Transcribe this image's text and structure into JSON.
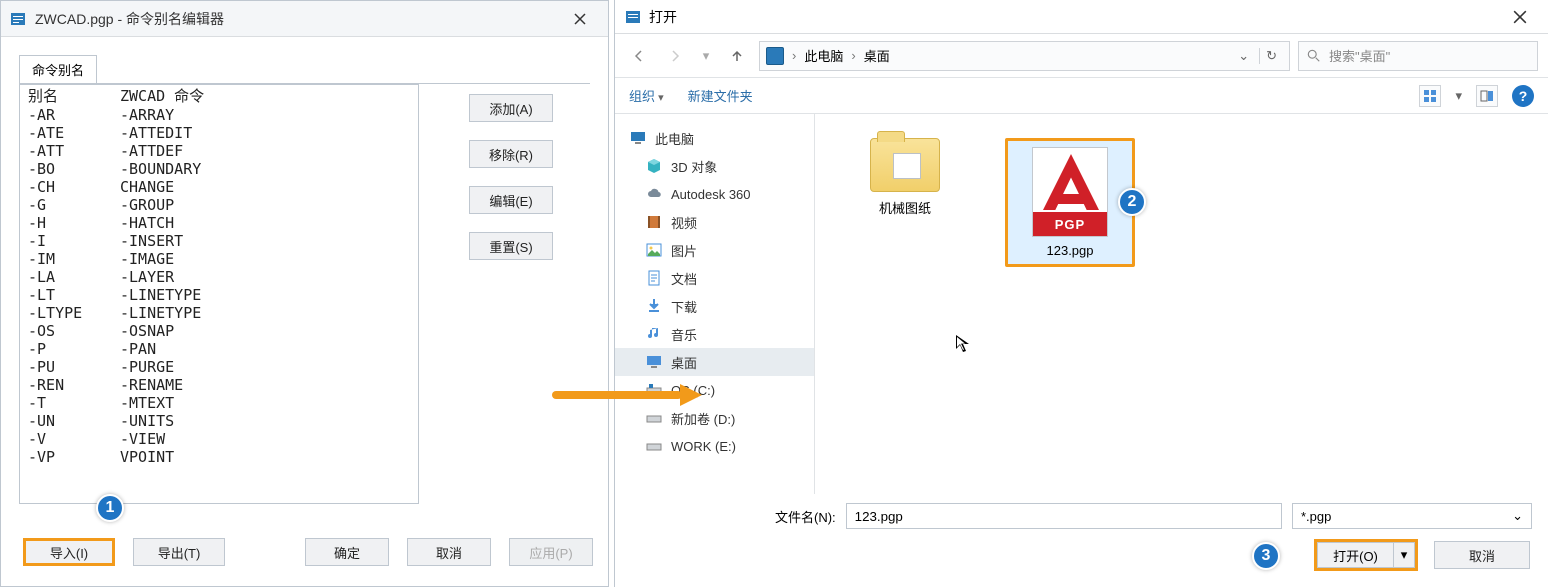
{
  "left": {
    "title": "ZWCAD.pgp - 命令别名编辑器",
    "tab": "命令别名",
    "list_header": {
      "alias": "别名",
      "cmd": "ZWCAD 命令"
    },
    "list": [
      {
        "a": "-AR",
        "c": "-ARRAY"
      },
      {
        "a": "-ATE",
        "c": "-ATTEDIT"
      },
      {
        "a": "-ATT",
        "c": "-ATTDEF"
      },
      {
        "a": "-BO",
        "c": "-BOUNDARY"
      },
      {
        "a": "-CH",
        "c": "CHANGE"
      },
      {
        "a": "-G",
        "c": "-GROUP"
      },
      {
        "a": "-H",
        "c": "-HATCH"
      },
      {
        "a": "-I",
        "c": "-INSERT"
      },
      {
        "a": "-IM",
        "c": "-IMAGE"
      },
      {
        "a": "-LA",
        "c": "-LAYER"
      },
      {
        "a": "-LT",
        "c": "-LINETYPE"
      },
      {
        "a": "-LTYPE",
        "c": "-LINETYPE"
      },
      {
        "a": "-OS",
        "c": "-OSNAP"
      },
      {
        "a": "-P",
        "c": "-PAN"
      },
      {
        "a": "-PU",
        "c": "-PURGE"
      },
      {
        "a": "-REN",
        "c": "-RENAME"
      },
      {
        "a": "-T",
        "c": "-MTEXT"
      },
      {
        "a": "-UN",
        "c": "-UNITS"
      },
      {
        "a": "-V",
        "c": "-VIEW"
      },
      {
        "a": "-VP",
        "c": "VPOINT"
      }
    ],
    "buttons": {
      "add": "添加(A)",
      "remove": "移除(R)",
      "edit": "编辑(E)",
      "reset": "重置(S)",
      "import": "导入(I)",
      "export": "导出(T)",
      "ok": "确定",
      "cancel": "取消",
      "apply": "应用(P)"
    }
  },
  "right": {
    "title": "打开",
    "crumbs": {
      "pc": "此电脑",
      "desktop": "桌面"
    },
    "search_placeholder": "搜索\"桌面\"",
    "toolbar": {
      "organize": "组织",
      "newfolder": "新建文件夹"
    },
    "tree": {
      "root": "此电脑",
      "items": [
        {
          "label": "3D 对象",
          "icon": "cube"
        },
        {
          "label": "Autodesk 360",
          "icon": "cloud"
        },
        {
          "label": "视频",
          "icon": "film"
        },
        {
          "label": "图片",
          "icon": "picture"
        },
        {
          "label": "文档",
          "icon": "doc"
        },
        {
          "label": "下载",
          "icon": "download"
        },
        {
          "label": "音乐",
          "icon": "music"
        },
        {
          "label": "桌面",
          "icon": "desktop",
          "selected": true
        },
        {
          "label": "OS (C:)",
          "icon": "drive-win"
        },
        {
          "label": "新加卷 (D:)",
          "icon": "drive"
        },
        {
          "label": "WORK (E:)",
          "icon": "drive"
        }
      ]
    },
    "files": {
      "folder1": "机械图纸",
      "pgpfile": "123.pgp",
      "pgp_badge": "PGP"
    },
    "filename_label": "文件名(N):",
    "filename_value": "123.pgp",
    "filetype": "*.pgp",
    "open_btn": "打开(O)",
    "cancel_btn": "取消"
  },
  "badges": {
    "b1": "1",
    "b2": "2",
    "b3": "3"
  }
}
